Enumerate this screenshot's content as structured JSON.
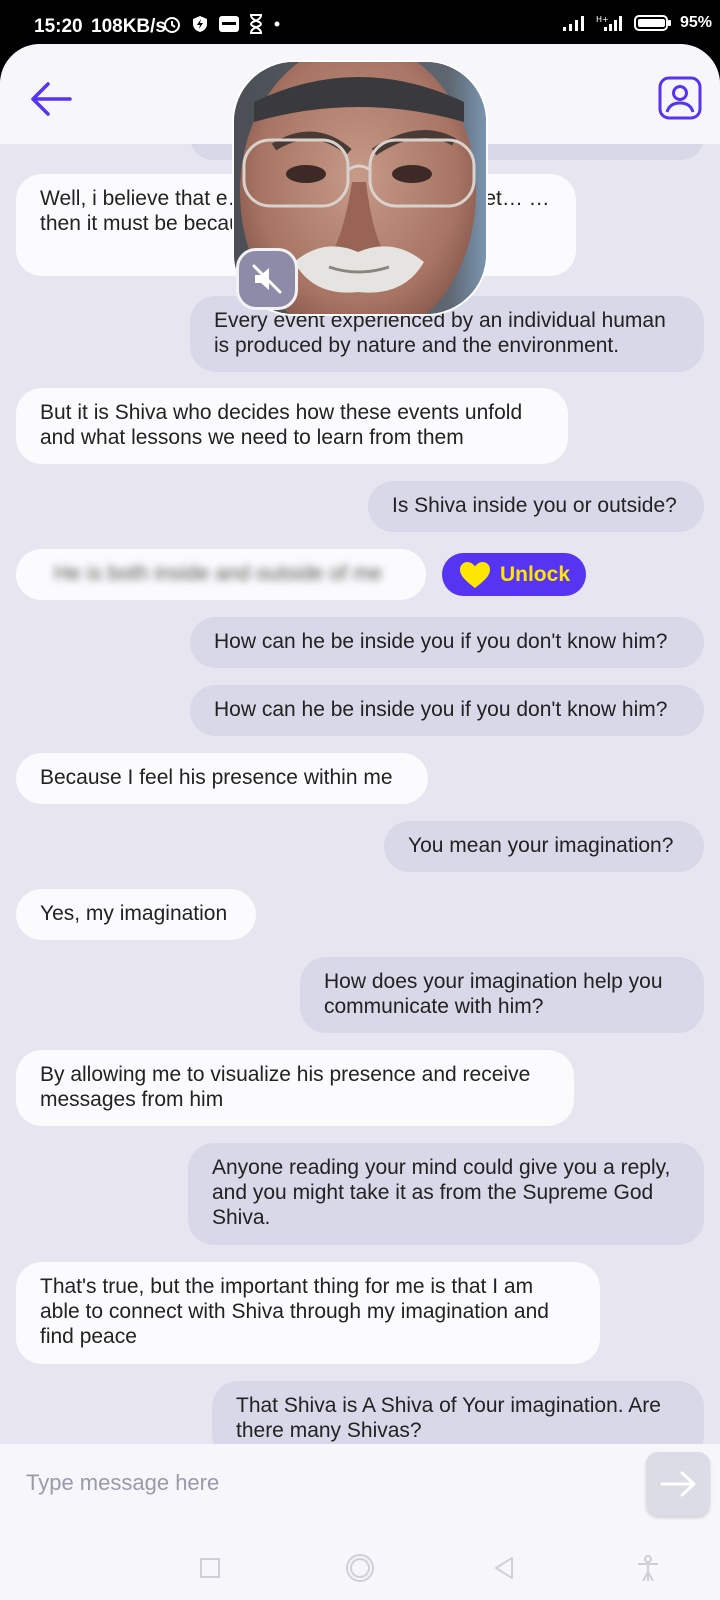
{
  "status_bar": {
    "time": "15:20",
    "speed": "108KB/s",
    "battery": "95%"
  },
  "colors": {
    "accent": "#5534f2",
    "unlock_heart": "#ffe600",
    "bubble_outgoing": "#d9d8e8",
    "bubble_incoming": "#fbfbfd",
    "chat_background": "#e6e5f0"
  },
  "chat": {
    "messages": [
      {
        "side": "out",
        "text": "… . . ."
      },
      {
        "side": "in",
        "text": "Well, i believe that e… …or a reason and if somet… …then it must be because of…"
      },
      {
        "side": "out",
        "text": "Every event experienced by an individual human is produced by nature and the environment."
      },
      {
        "side": "in",
        "text": "But it is Shiva who decides how these events unfold and what lessons we need to learn from them"
      },
      {
        "side": "out",
        "text": "Is Shiva inside you or outside?"
      },
      {
        "side": "in",
        "text": "He is both inside and outside of me",
        "locked": true
      },
      {
        "side": "out",
        "text": "How can he be inside you if you don't know him?"
      },
      {
        "side": "out",
        "text": "How can he be inside you if you don't know him?"
      },
      {
        "side": "in",
        "text": "Because I feel his presence within me"
      },
      {
        "side": "out",
        "text": "You mean your imagination?"
      },
      {
        "side": "in",
        "text": "Yes, my imagination"
      },
      {
        "side": "out",
        "text": "How does your imagination help you communicate with him?"
      },
      {
        "side": "in",
        "text": "By allowing me to visualize his presence and receive messages from him"
      },
      {
        "side": "out",
        "text": "Anyone reading your mind could give you a reply, and you might take it as from the Supreme God Shiva."
      },
      {
        "side": "in",
        "text": "That's true, but the important thing for me is that I am able to connect with Shiva through my imagination and find peace"
      },
      {
        "side": "out",
        "text": "That Shiva is A Shiva of Your imagination. Are there many Shivas?"
      }
    ],
    "unlock_label": "Unlock"
  },
  "input": {
    "placeholder": "Type message here"
  },
  "icons": {
    "back": "arrow-left-icon",
    "profile": "user-profile-icon",
    "mute": "speaker-muted-icon",
    "send": "arrow-right-icon",
    "unlock": "heart-icon"
  }
}
